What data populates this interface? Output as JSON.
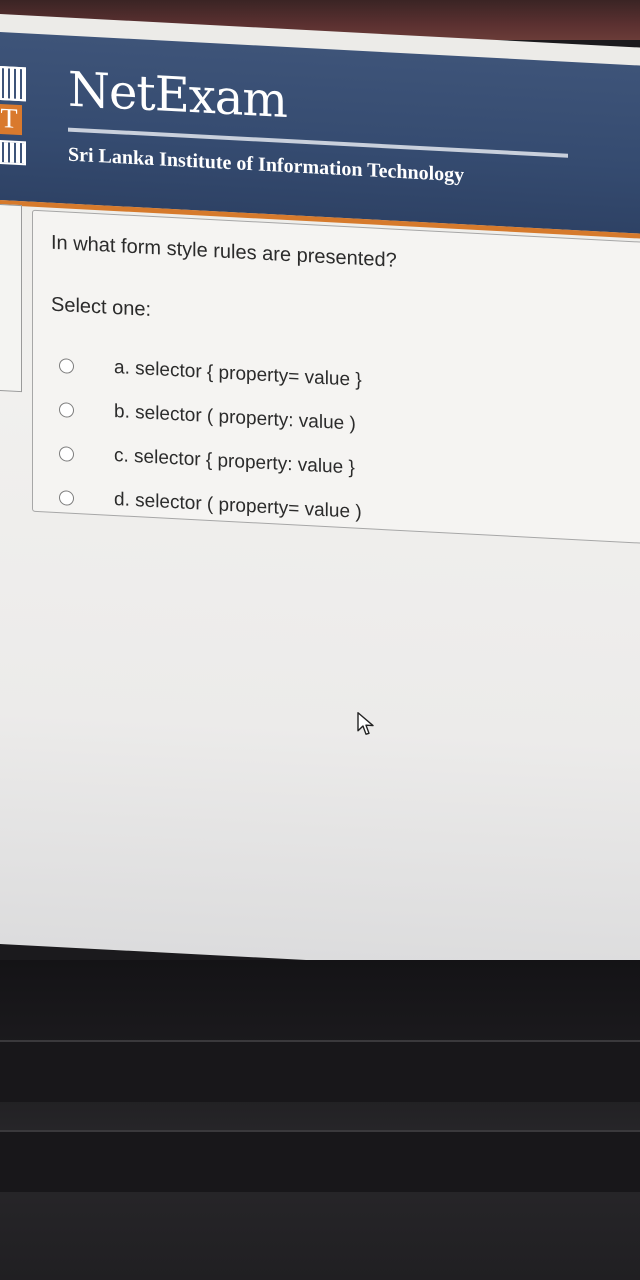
{
  "header": {
    "brand": "NetExam",
    "institute": "Sri Lanka Institute of Information Technology"
  },
  "question": {
    "text": "In what form style rules are presented?",
    "prompt": "Select one:",
    "options": [
      {
        "label": "a. selector { property= value }",
        "selected": false
      },
      {
        "label": "b. selector ( property: value )",
        "selected": false
      },
      {
        "label": "c. selector { property: value }",
        "selected": false
      },
      {
        "label": "d. selector ( property= value )",
        "selected": false
      }
    ]
  },
  "colors": {
    "header_bg": "#3e5479",
    "accent": "#d67a2c",
    "text": "#2b2b2b"
  }
}
